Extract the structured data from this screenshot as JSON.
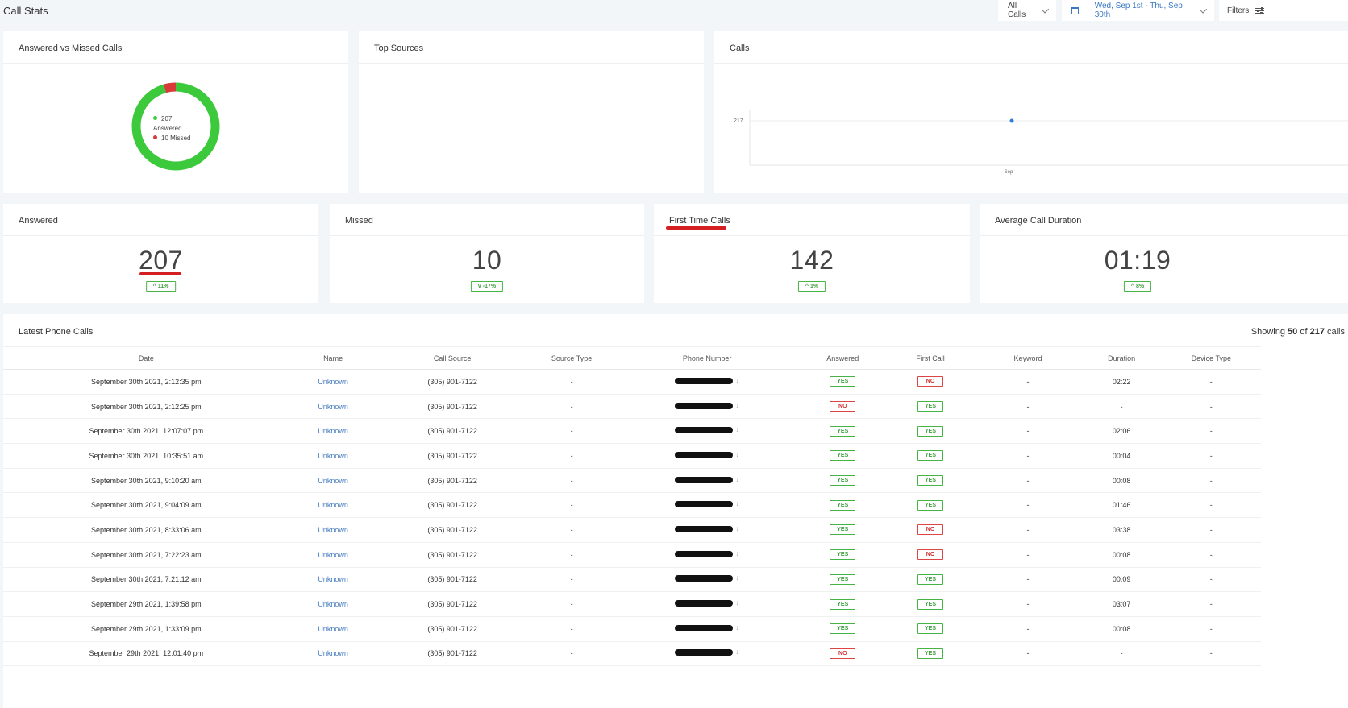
{
  "header": {
    "title": "Call Stats",
    "all_calls_label": "All Calls",
    "date_range_label": "Wed, Sep 1st - Thu, Sep 30th",
    "filters_label": "Filters"
  },
  "answered_vs_missed": {
    "title": "Answered vs Missed Calls",
    "answered_count": "207",
    "answered_label": "Answered",
    "missed_label": "10 Missed",
    "answered_value": 207,
    "missed_value": 10,
    "answered_color": "#3cc93c",
    "missed_color": "#d93a3a"
  },
  "top_sources": {
    "title": "Top Sources"
  },
  "calls_chart": {
    "title": "Calls",
    "y_tick": "217",
    "x_tick": "Sep"
  },
  "chart_data": [
    {
      "type": "pie",
      "title": "Answered vs Missed Calls",
      "categories": [
        "Answered",
        "Missed"
      ],
      "values": [
        207,
        10
      ]
    },
    {
      "type": "line",
      "title": "Calls",
      "categories": [
        "Sep"
      ],
      "values": [
        217
      ]
    }
  ],
  "stats": {
    "answered": {
      "label": "Answered",
      "value": "207",
      "change": "^ 11%"
    },
    "missed": {
      "label": "Missed",
      "value": "10",
      "change": "v -17%"
    },
    "first_time": {
      "label": "First Time Calls",
      "value": "142",
      "change": "^ 1%"
    },
    "avg_duration": {
      "label": "Average Call Duration",
      "value": "01:19",
      "change": "^ 8%"
    }
  },
  "table": {
    "title": "Latest Phone Calls",
    "showing_prefix": "Showing ",
    "showing_count": "50",
    "showing_mid": " of ",
    "showing_total": "217",
    "showing_suffix": " calls",
    "columns": [
      "Date",
      "Name",
      "Call Source",
      "Source Type",
      "Phone Number",
      "Answered",
      "First Call",
      "Keyword",
      "Duration",
      "Device Type"
    ],
    "rows": [
      {
        "date": "September 30th 2021, 2:12:35 pm",
        "name": "Unknown",
        "source": "(305) 901-7122",
        "source_type": "-",
        "answered": "YES",
        "first_call": "NO",
        "keyword": "-",
        "duration": "02:22",
        "device": "-"
      },
      {
        "date": "September 30th 2021, 2:12:25 pm",
        "name": "Unknown",
        "source": "(305) 901-7122",
        "source_type": "-",
        "answered": "NO",
        "first_call": "YES",
        "keyword": "-",
        "duration": "-",
        "device": "-"
      },
      {
        "date": "September 30th 2021, 12:07:07 pm",
        "name": "Unknown",
        "source": "(305) 901-7122",
        "source_type": "-",
        "answered": "YES",
        "first_call": "YES",
        "keyword": "-",
        "duration": "02:06",
        "device": "-"
      },
      {
        "date": "September 30th 2021, 10:35:51 am",
        "name": "Unknown",
        "source": "(305) 901-7122",
        "source_type": "-",
        "answered": "YES",
        "first_call": "YES",
        "keyword": "-",
        "duration": "00:04",
        "device": "-"
      },
      {
        "date": "September 30th 2021, 9:10:20 am",
        "name": "Unknown",
        "source": "(305) 901-7122",
        "source_type": "-",
        "answered": "YES",
        "first_call": "YES",
        "keyword": "-",
        "duration": "00:08",
        "device": "-"
      },
      {
        "date": "September 30th 2021, 9:04:09 am",
        "name": "Unknown",
        "source": "(305) 901-7122",
        "source_type": "-",
        "answered": "YES",
        "first_call": "YES",
        "keyword": "-",
        "duration": "01:46",
        "device": "-"
      },
      {
        "date": "September 30th 2021, 8:33:06 am",
        "name": "Unknown",
        "source": "(305) 901-7122",
        "source_type": "-",
        "answered": "YES",
        "first_call": "NO",
        "keyword": "-",
        "duration": "03:38",
        "device": "-"
      },
      {
        "date": "September 30th 2021, 7:22:23 am",
        "name": "Unknown",
        "source": "(305) 901-7122",
        "source_type": "-",
        "answered": "YES",
        "first_call": "NO",
        "keyword": "-",
        "duration": "00:08",
        "device": "-"
      },
      {
        "date": "September 30th 2021, 7:21:12 am",
        "name": "Unknown",
        "source": "(305) 901-7122",
        "source_type": "-",
        "answered": "YES",
        "first_call": "YES",
        "keyword": "-",
        "duration": "00:09",
        "device": "-"
      },
      {
        "date": "September 29th 2021, 1:39:58 pm",
        "name": "Unknown",
        "source": "(305) 901-7122",
        "source_type": "-",
        "answered": "YES",
        "first_call": "YES",
        "keyword": "-",
        "duration": "03:07",
        "device": "-"
      },
      {
        "date": "September 29th 2021, 1:33:09 pm",
        "name": "Unknown",
        "source": "(305) 901-7122",
        "source_type": "-",
        "answered": "YES",
        "first_call": "YES",
        "keyword": "-",
        "duration": "00:08",
        "device": "-"
      },
      {
        "date": "September 29th 2021, 12:01:40 pm",
        "name": "Unknown",
        "source": "(305) 901-7122",
        "source_type": "-",
        "answered": "NO",
        "first_call": "YES",
        "keyword": "-",
        "duration": "-",
        "device": "-"
      }
    ]
  }
}
